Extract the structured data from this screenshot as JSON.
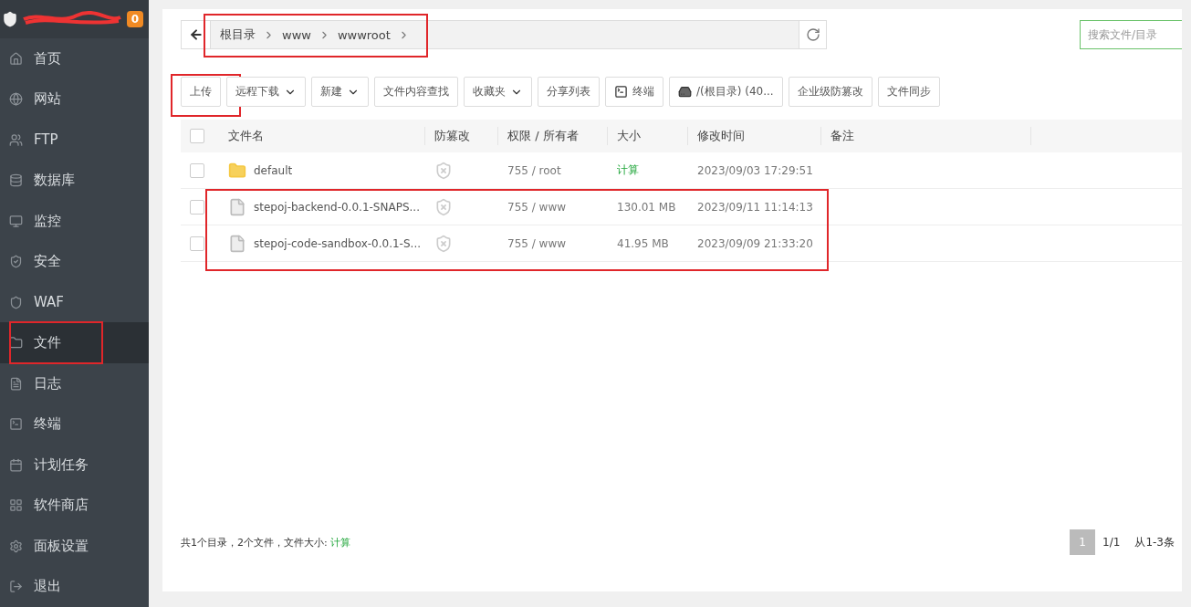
{
  "server": {
    "redacted": true,
    "badge": "0"
  },
  "sidebar": {
    "items": [
      {
        "label": "首页",
        "selected": false,
        "marked": false
      },
      {
        "label": "网站",
        "selected": false,
        "marked": false
      },
      {
        "label": "FTP",
        "selected": false,
        "marked": false
      },
      {
        "label": "数据库",
        "selected": false,
        "marked": false
      },
      {
        "label": "监控",
        "selected": false,
        "marked": false
      },
      {
        "label": "安全",
        "selected": false,
        "marked": false
      },
      {
        "label": "WAF",
        "selected": false,
        "marked": false
      },
      {
        "label": "文件",
        "selected": true,
        "marked": true
      },
      {
        "label": "日志",
        "selected": false,
        "marked": false
      },
      {
        "label": "终端",
        "selected": false,
        "marked": false
      },
      {
        "label": "计划任务",
        "selected": false,
        "marked": false
      },
      {
        "label": "软件商店",
        "selected": false,
        "marked": false
      },
      {
        "label": "面板设置",
        "selected": false,
        "marked": false
      },
      {
        "label": "退出",
        "selected": false,
        "marked": false
      }
    ]
  },
  "path_bar": {
    "marked": true,
    "segments": [
      "根目录",
      "www",
      "wwwroot"
    ]
  },
  "search": {
    "placeholder": "搜索文件/目录"
  },
  "toolbar": [
    {
      "kind": "plain",
      "label": "上传",
      "marked": true
    },
    {
      "kind": "dropdown",
      "label": "远程下载",
      "marked": false
    },
    {
      "kind": "dropdown",
      "label": "新建",
      "marked": false
    },
    {
      "kind": "plain",
      "label": "文件内容查找",
      "marked": false
    },
    {
      "kind": "dropdown",
      "label": "收藏夹",
      "marked": false
    },
    {
      "kind": "plain",
      "label": "分享列表",
      "marked": false
    },
    {
      "kind": "terminal",
      "label": "终端",
      "marked": false
    },
    {
      "kind": "drive",
      "label": "/(根目录) (40...",
      "marked": false
    },
    {
      "kind": "plain",
      "label": "企业级防篡改",
      "marked": false
    },
    {
      "kind": "plain",
      "label": "文件同步",
      "marked": false
    }
  ],
  "table": {
    "all_checked": false,
    "columns": [
      "文件名",
      "防篡改",
      "权限 / 所有者",
      "大小",
      "修改时间",
      "备注"
    ],
    "rows": [
      {
        "kind": "folder",
        "name": "default",
        "checked": false,
        "permission": "755 / root",
        "size": "计算",
        "size_link": true,
        "modified": "2023/09/03 17:29:51",
        "marked": false
      },
      {
        "kind": "file",
        "name": "stepoj-backend-0.0.1-SNAPS...",
        "checked": false,
        "permission": "755 / www",
        "size": "130.01 MB",
        "size_link": false,
        "modified": "2023/09/11 11:14:13",
        "marked": true
      },
      {
        "kind": "file",
        "name": "stepoj-code-sandbox-0.0.1-S...",
        "checked": false,
        "permission": "755 / www",
        "size": "41.95 MB",
        "size_link": false,
        "modified": "2023/09/09 21:33:20",
        "marked": true
      }
    ]
  },
  "footer": {
    "summary": "共1个目录，2个文件，文件大小:",
    "size_link": "计算",
    "pages": [
      {
        "label": "1",
        "selected": true
      }
    ],
    "page_count": "1/1",
    "range": "从1-3条"
  }
}
